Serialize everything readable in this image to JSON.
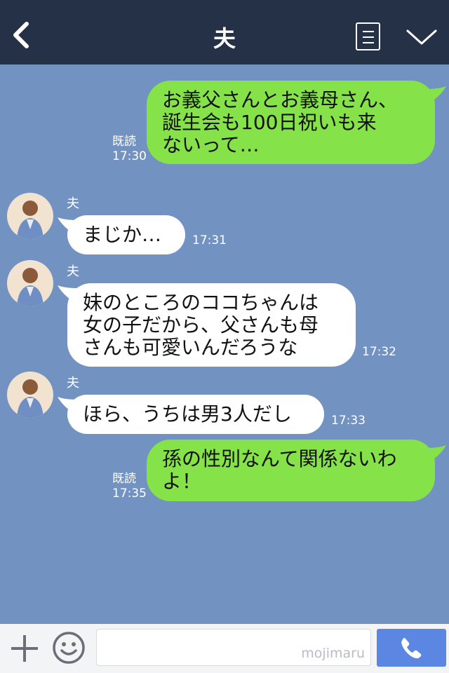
{
  "header": {
    "title": "夫"
  },
  "messages": [
    {
      "side": "me",
      "lines": [
        "お義父さんとお義母さん、",
        "誕生会も100日祝いも来",
        "ないって…"
      ],
      "read": "既読",
      "time": "17:30"
    },
    {
      "side": "you",
      "name": "夫",
      "lines": [
        "まじか…"
      ],
      "time": "17:31"
    },
    {
      "side": "you",
      "name": "夫",
      "lines": [
        "妹のところのココちゃんは",
        "女の子だから、父さんも母",
        "さんも可愛いんだろうな"
      ],
      "time": "17:32"
    },
    {
      "side": "you",
      "name": "夫",
      "lines": [
        "ほら、うちは男3人だし"
      ],
      "time": "17:33"
    },
    {
      "side": "me",
      "lines": [
        "孫の性別なんて関係ないわ",
        "よ！"
      ],
      "read": "既読",
      "time": "17:35"
    }
  ],
  "footer": {
    "input_value": "",
    "watermark": "mojimaru"
  },
  "colors": {
    "header_bg": "#253146",
    "chat_bg": "#7293c2",
    "my_bubble": "#85e249",
    "their_bubble": "#ffffff",
    "call_button": "#5b86e2"
  },
  "icons": [
    "back-arrow-icon",
    "menu-list-icon",
    "chevron-down-icon",
    "plus-icon",
    "smiley-icon",
    "phone-icon"
  ]
}
